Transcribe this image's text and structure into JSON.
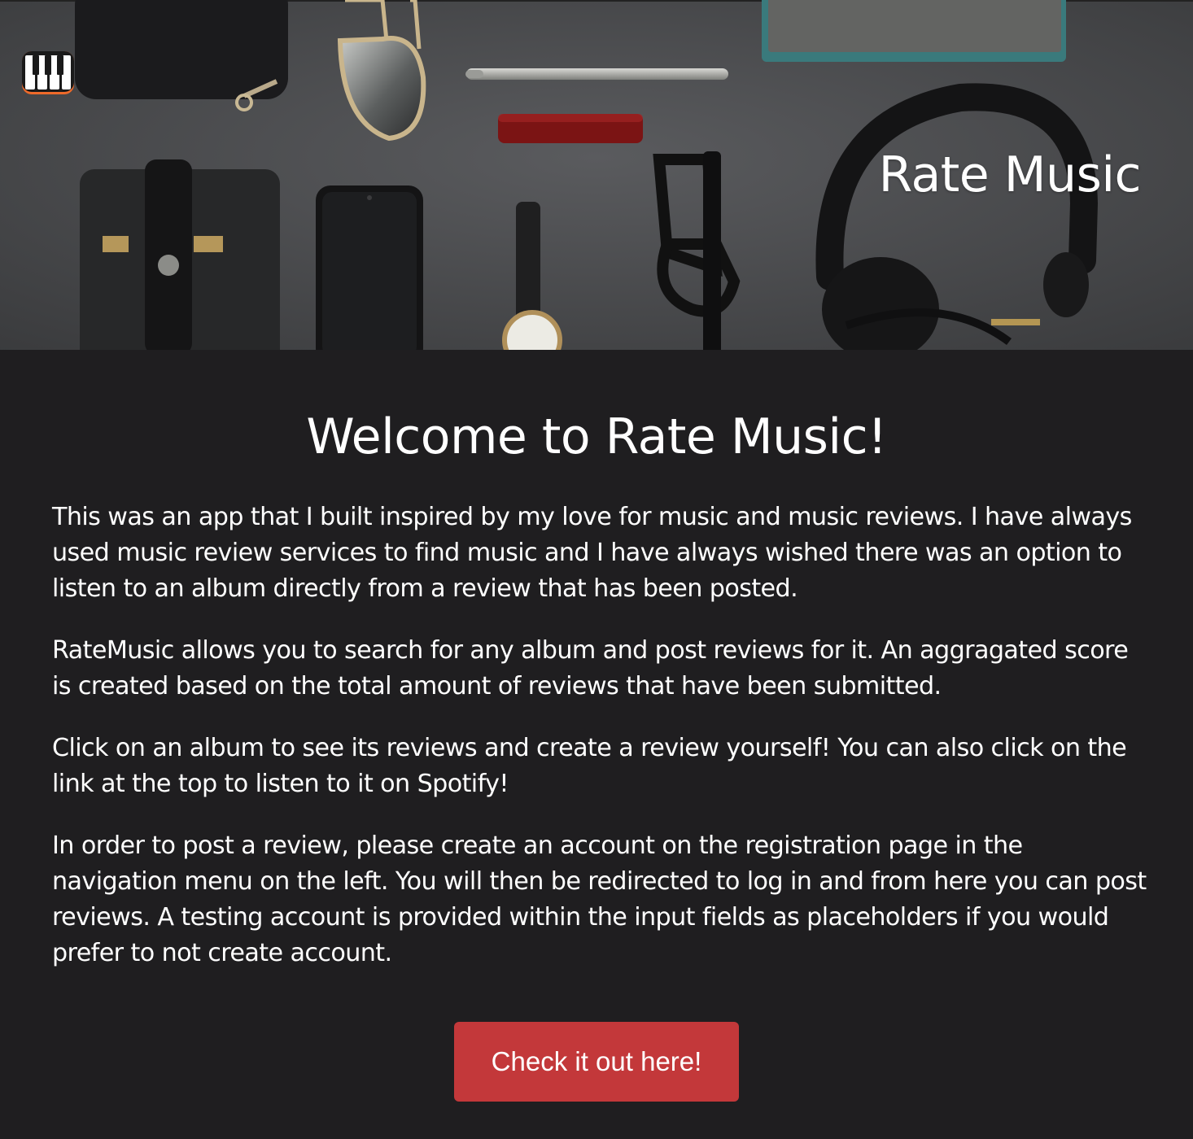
{
  "header": {
    "logo_icon": "piano-keys-icon",
    "title": "Rate Music"
  },
  "main": {
    "heading": "Welcome to Rate Music!",
    "paragraphs": [
      "This was an app that I built inspired by my love for music and music reviews. I have always used music review services to find music and I have always wished there was an option to listen to an album directly from a review that has been posted.",
      "RateMusic allows you to search for any album and post reviews for it. An aggragated score is created based on the total amount of reviews that have been submitted.",
      "Click on an album to see its reviews and create a review yourself! You can also click on the link at the top to listen to it on Spotify!",
      "In order to post a review, please create an account on the registration page in the navigation menu on the left. You will then be redirected to log in and from here you can post reviews. A testing account is provided within the input fields as placeholders if you would prefer to not create account."
    ],
    "cta_label": "Check it out here!"
  },
  "colors": {
    "page_background": "#1f1e20",
    "cta_background": "#c3383a",
    "text": "#ffffff",
    "hero_surface": "#4a4b4d"
  }
}
